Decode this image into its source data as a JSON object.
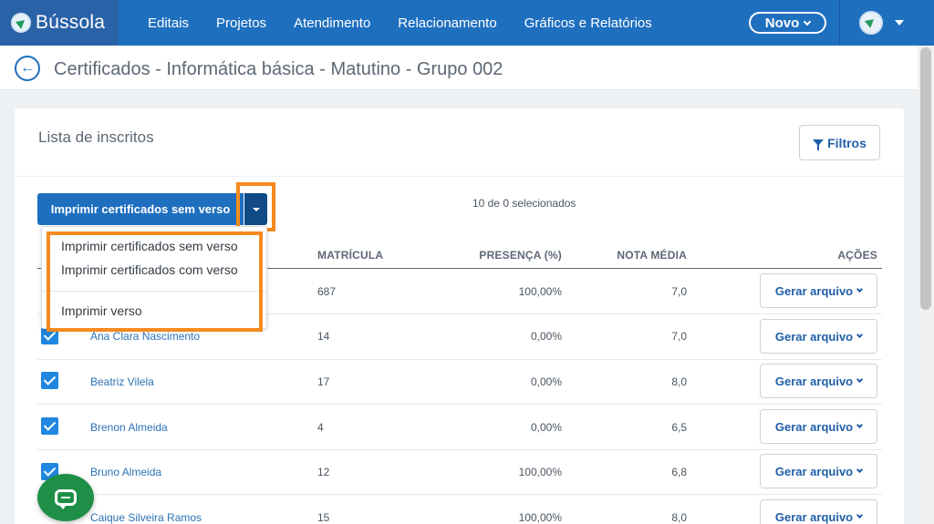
{
  "brand": {
    "name": "Bússola",
    "color": "#1f6fbf"
  },
  "nav": {
    "items": [
      "Editais",
      "Projetos",
      "Atendimento",
      "Relacionamento",
      "Gráficos e Relatórios"
    ],
    "new_button": "Novo"
  },
  "page": {
    "title": "Certificados - Informática básica - Matutino - Grupo 002"
  },
  "card": {
    "title": "Lista de inscritos",
    "filter_button": "Filtros",
    "print_button": "Imprimir certificados sem verso",
    "selected_count": "10 de 0 selecionados"
  },
  "menu": {
    "items": [
      "Imprimir certificados sem verso",
      "Imprimir certificados com verso",
      "Imprimir verso"
    ]
  },
  "table": {
    "headers": [
      "MATRÍCULA",
      "PRESENÇA (%)",
      "NOTA MÉDIA",
      "AÇÕES"
    ],
    "action_label": "Gerar arquivo",
    "rows": [
      {
        "name": "",
        "matricula": "687",
        "presenca": "100,00%",
        "nota": "7,0",
        "checked": true
      },
      {
        "name": "Ana Clara Nascimento",
        "matricula": "14",
        "presenca": "0,00%",
        "nota": "7,0",
        "checked": true
      },
      {
        "name": "Beatriz Vilela",
        "matricula": "17",
        "presenca": "0,00%",
        "nota": "8,0",
        "checked": true
      },
      {
        "name": "Brenon Almeida",
        "matricula": "4",
        "presenca": "0,00%",
        "nota": "6,5",
        "checked": true
      },
      {
        "name": "Bruno Almeida",
        "matricula": "12",
        "presenca": "100,00%",
        "nota": "6,8",
        "checked": true
      },
      {
        "name": "Caique Silveira Ramos",
        "matricula": "15",
        "presenca": "100,00%",
        "nota": "8,0",
        "checked": true
      }
    ]
  },
  "highlight_color": "#f58a1f"
}
